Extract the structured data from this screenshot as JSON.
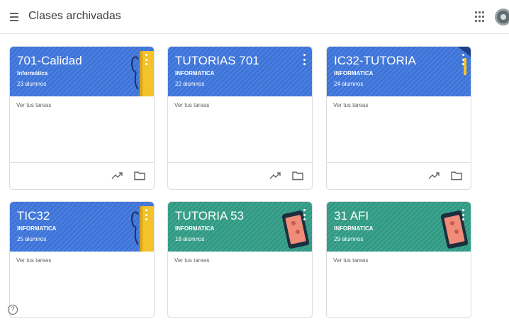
{
  "header": {
    "title": "Clases archivadas",
    "menu_icon": "menu-icon",
    "apps_icon": "apps-grid-icon",
    "avatar_icon": "account-avatar"
  },
  "todo_label": "Ver tus tareas",
  "cards": [
    {
      "title": "701-Calidad",
      "section": "Informática",
      "students": "23 alumnos",
      "theme": "blue",
      "illustration": "notebook"
    },
    {
      "title": "TUTORIAS 701",
      "section": "INFORMATICA",
      "students": "22 alumnos",
      "theme": "blue",
      "illustration": "none"
    },
    {
      "title": "IC32-TUTORIA",
      "section": "INFORMATICA",
      "students": "24 alumnos",
      "theme": "blue",
      "illustration": "none"
    },
    {
      "title": "TIC32",
      "section": "INFORMATICA",
      "students": "25 alumnos",
      "theme": "blue",
      "illustration": "notebook"
    },
    {
      "title": "TUTORIA 53",
      "section": "INFORMATICA",
      "students": "18 alumnos",
      "theme": "teal",
      "illustration": "phone"
    },
    {
      "title": "31 AFI",
      "section": "INFORMATICA",
      "students": "29 alumnos",
      "theme": "teal",
      "illustration": "phone"
    }
  ],
  "colors": {
    "blue": "#3b73d9",
    "teal": "#2f9a83"
  },
  "help_icon": "help-icon",
  "help_label": "?"
}
